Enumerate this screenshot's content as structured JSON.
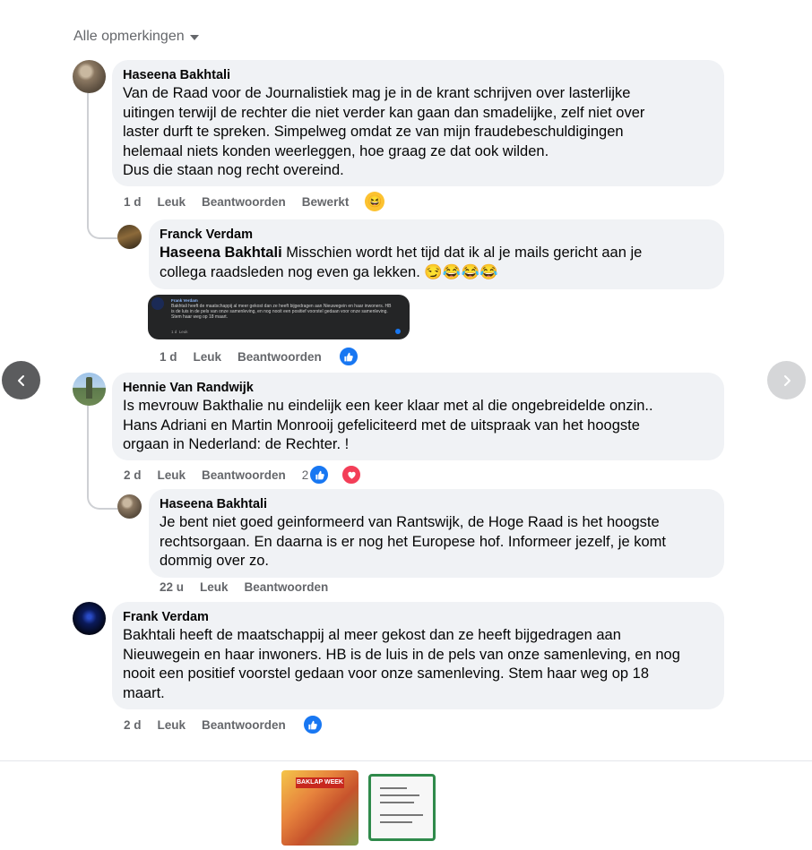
{
  "filter": {
    "label": "Alle opmerkingen"
  },
  "comments": [
    {
      "author": "Haseena Bakhtali",
      "text": "Van de Raad voor de Journalistiek mag je in de krant schrijven over lasterlijke\nuitingen terwijl de rechter die niet verder kan gaan dan smadelijke, zelf niet over\nlaster durft te spreken. Simpelweg omdat ze van mijn fraudebeschuldigingen\nhelemaal niets konden weerleggen, hoe graag ze dat ook wilden.\nDus die staan nog recht overeind.",
      "time": "1 d",
      "like": "Leuk",
      "reply": "Beantwoorden",
      "edited": "Bewerkt",
      "reactions": [
        "haha"
      ]
    },
    {
      "author": "Franck Verdam",
      "mention": "Haseena Bakhtali",
      "text": " Misschien wordt het tijd dat ik al je mails gericht aan je\ncollega raadsleden nog even ga lekken. 😏😂😂😂",
      "attachment": {
        "author": "Frank Verdam",
        "text": "Bakhtali heeft de maatschappij al meer gekost dan ze heeft bijgedragen aan Nieuwegein en haar inwoners. HB is de luis in de pels van onze samenleving, en nog nooit een positief voorstel gedaan voor onze samenleving. Stem haar weg op 18 maart.",
        "time": "1 d",
        "like": "Leuk"
      },
      "time": "1 d",
      "like": "Leuk",
      "reply": "Beantwoorden",
      "reactions": [
        "like"
      ]
    },
    {
      "author": "Hennie Van Randwijk",
      "text": "Is mevrouw Bakthalie nu eindelijk een keer klaar met al die ongebreidelde onzin..\nHans Adriani en Martin Monrooij gefeliciteerd met de uitspraak van het hoogste\norgaan in Nederland: de Rechter. !",
      "time": "2 d",
      "like": "Leuk",
      "reply": "Beantwoorden",
      "reaction_count": "2",
      "reactions": [
        "like",
        "love"
      ]
    },
    {
      "author": "Haseena Bakhtali",
      "text": "Je bent niet goed geinformeerd van Rantswijk, de Hoge Raad is het hoogste\nrechtsorgaan. En daarna is er nog het Europese hof. Informeer jezelf, je komt\ndommig over zo.",
      "time": "22 u",
      "like": "Leuk",
      "reply": "Beantwoorden"
    },
    {
      "author": "Frank Verdam",
      "text": "Bakhtali heeft de maatschappij al meer gekost dan ze heeft bijgedragen aan\nNieuwegein en haar inwoners. HB is de luis in de pels van onze samenleving, en nog\nnooit een positief voorstel gedaan voor onze samenleving. Stem haar weg op 18\nmaart.",
      "time": "2 d",
      "like": "Leuk",
      "reply": "Beantwoorden",
      "reactions": [
        "like"
      ]
    }
  ],
  "thumbnails": [
    {
      "title": "BAKLAP WEEK"
    },
    {
      "title": ""
    }
  ],
  "colors": {
    "bubble": "#f0f2f5",
    "meta": "#65676b",
    "like": "#1877f2",
    "love": "#f33e58",
    "haha": "#fcc230",
    "thumb_border": "#2f8a4b"
  }
}
